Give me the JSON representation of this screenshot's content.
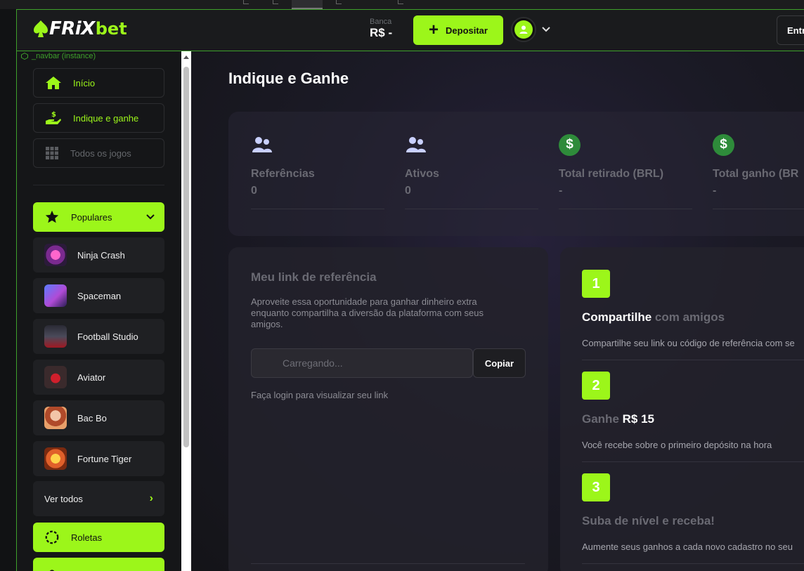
{
  "header": {
    "logo_main": "FRiX",
    "logo_sub": "bet",
    "balance_label": "Banca",
    "balance_value": "R$ -",
    "deposit_label": "Depositar",
    "login_label": "Entr"
  },
  "devtools_label": "_navbar (instance)",
  "sidebar": {
    "nav": [
      {
        "label": "Início",
        "icon": "home-icon"
      },
      {
        "label": "Indique e ganhe",
        "icon": "referral-icon"
      },
      {
        "label": "Todos os jogos",
        "icon": "grid-icon"
      }
    ],
    "popular_label": "Populares",
    "games": [
      {
        "label": "Ninja Crash",
        "icon": "ninja-crash-thumb"
      },
      {
        "label": "Spaceman",
        "icon": "spaceman-thumb"
      },
      {
        "label": "Football Studio",
        "icon": "football-studio-thumb"
      },
      {
        "label": "Aviator",
        "icon": "aviator-thumb"
      },
      {
        "label": "Bac Bo",
        "icon": "bac-bo-thumb"
      },
      {
        "label": "Fortune Tiger",
        "icon": "fortune-tiger-thumb"
      }
    ],
    "see_all_label": "Ver todos",
    "roulettes_label": "Roletas"
  },
  "main": {
    "title": "Indique e Ganhe",
    "stats": [
      {
        "label": "Referências",
        "value": "0",
        "icon": "users-icon"
      },
      {
        "label": "Ativos",
        "value": "0",
        "icon": "users-icon"
      },
      {
        "label": "Total retirado (BRL)",
        "value": "-",
        "icon": "dollar-icon"
      },
      {
        "label": "Total ganho (BR",
        "value": "-",
        "icon": "dollar-icon"
      }
    ],
    "referral": {
      "title": "Meu link de referência",
      "description": "Aproveite essa oportunidade para ganhar dinheiro extra enquanto compartilha a diversão da plataforma com seus amigos.",
      "input_placeholder": "Carregando...",
      "copy_label": "Copiar",
      "login_msg": "Faça login para visualizar seu link"
    },
    "steps": [
      {
        "num": "1",
        "bold": "Compartilhe",
        "rest": " com amigos",
        "sub": "Compartilhe seu link ou código de referência com se"
      },
      {
        "num": "2",
        "bold": "R$ 15",
        "rest": "Ganhe ",
        "sub": "Você recebe sobre o primeiro depósito na hora"
      },
      {
        "num": "3",
        "bold": "",
        "rest": "Suba de nível e receba!",
        "sub": "Aumente seus ganhos a cada novo cadastro no seu"
      }
    ]
  },
  "colors": {
    "accent": "#9cf61a",
    "bg": "#141418",
    "dollar": "#2e8b3a"
  }
}
